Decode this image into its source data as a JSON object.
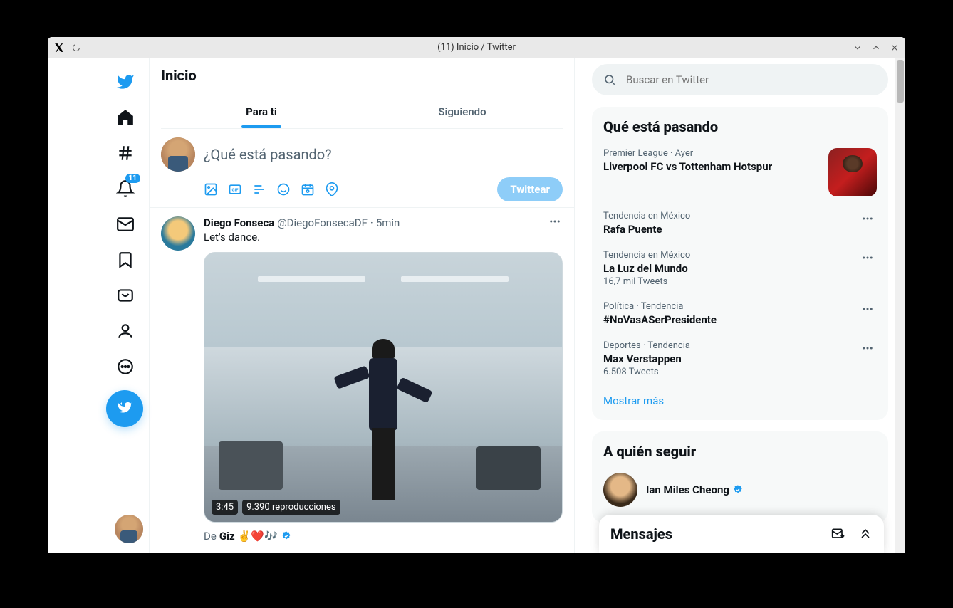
{
  "window": {
    "title": "(11) Inicio / Twitter"
  },
  "nav": {
    "badge_count": "11"
  },
  "header": {
    "title": "Inicio"
  },
  "tabs": {
    "for_you": "Para ti",
    "following": "Siguiendo"
  },
  "compose": {
    "placeholder": "¿Qué está pasando?",
    "button": "Twittear"
  },
  "tweet": {
    "author": "Diego Fonseca",
    "handle": "@DiegoFonsecaDF",
    "separator": "·",
    "time": "5min",
    "text": "Let's dance.",
    "video_duration": "3:45",
    "video_plays": "9.390 reproducciones",
    "source_prefix": "De",
    "source_name": "Giz",
    "source_emojis": "✌️❤️🎶"
  },
  "search": {
    "placeholder": "Buscar en Twitter"
  },
  "trends_panel": {
    "title": "Qué está pasando",
    "show_more": "Mostrar más",
    "items": [
      {
        "meta": "Premier League · Ayer",
        "name": "Liverpool FC vs Tottenham Hotspur",
        "count": "",
        "has_thumb": true
      },
      {
        "meta": "Tendencia en México",
        "name": "Rafa Puente",
        "count": "",
        "has_thumb": false
      },
      {
        "meta": "Tendencia en México",
        "name": "La Luz del Mundo",
        "count": "16,7 mil Tweets",
        "has_thumb": false
      },
      {
        "meta": "Política · Tendencia",
        "name": "#NoVasASerPresidente",
        "count": "",
        "has_thumb": false
      },
      {
        "meta": "Deportes · Tendencia",
        "name": "Max Verstappen",
        "count": "6.508 Tweets",
        "has_thumb": false
      }
    ]
  },
  "follow_panel": {
    "title": "A quién seguir",
    "items": [
      {
        "name": "Ian Miles Cheong"
      }
    ]
  },
  "messages": {
    "title": "Mensajes"
  }
}
